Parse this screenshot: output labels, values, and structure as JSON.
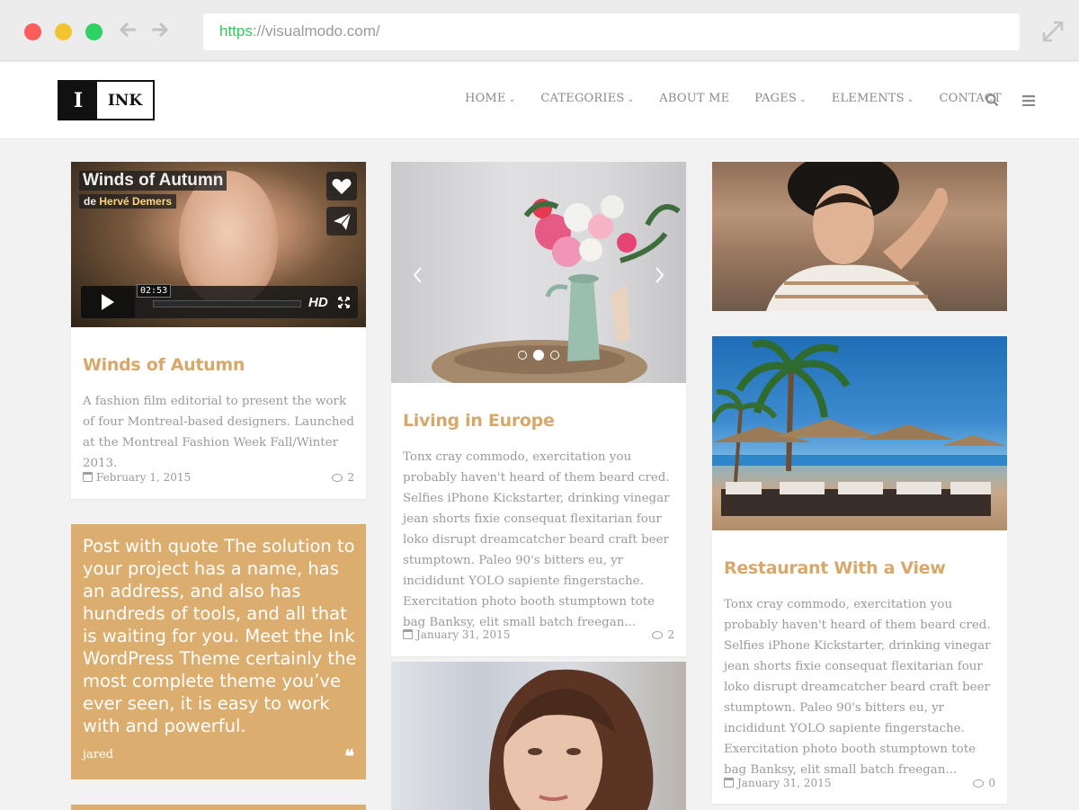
{
  "browser": {
    "url_protocol": "https",
    "url_rest": "://visualmodo.com/"
  },
  "site": {
    "logo_mark": "I",
    "logo_text": "INK",
    "menu": [
      {
        "label": "HOME",
        "has_dropdown": true
      },
      {
        "label": "CATEGORIES",
        "has_dropdown": true
      },
      {
        "label": "ABOUT ME",
        "has_dropdown": false
      },
      {
        "label": "PAGES",
        "has_dropdown": true
      },
      {
        "label": "ELEMENTS",
        "has_dropdown": true
      },
      {
        "label": "CONTACT",
        "has_dropdown": false
      }
    ],
    "accent_color": "#d7a86a",
    "quote_bg_color": "#dbae6f"
  },
  "posts": {
    "video": {
      "overlay_title": "Winds of Autumn",
      "overlay_author_prefix": "de",
      "overlay_author": "Hervé Demers",
      "timecode": "02:53",
      "hd_label": "HD",
      "title": "Winds of Autumn",
      "excerpt": "A fashion film editorial to present the work of four Montreal-based designers. Launched at the Montreal Fashion Week Fall/Winter 2013.",
      "date": "February 1, 2015",
      "comments": "2"
    },
    "quote": {
      "text": "Post with quote The solution to your project has a name, has an address, and also has hundreds of tools, and all that is waiting for you. Meet the Ink WordPress Theme certainly the most complete theme you’ve ever seen, it is easy to work with and powerful.",
      "author": "jared",
      "mark": "❝"
    },
    "europe": {
      "title": "Living in Europe",
      "excerpt": "Tonx cray commodo, exercitation you probably haven't heard of them beard cred. Selfies iPhone Kickstarter, drinking vinegar jean shorts fixie consequat flexitarian four loko disrupt dreamcatcher beard craft beer stumptown. Paleo 90's bitters eu, yr incididunt YOLO sapiente fingerstache. Exercitation photo booth stumptown tote bag Banksy, elit small batch freegan...",
      "date": "January 31, 2015",
      "comments": "2"
    },
    "restaurant": {
      "title": "Restaurant With a View",
      "excerpt": "Tonx cray commodo, exercitation you probably haven't heard of them beard cred. Selfies iPhone Kickstarter, drinking vinegar jean shorts fixie consequat flexitarian four loko disrupt dreamcatcher beard craft beer stumptown. Paleo 90's bitters eu, yr incididunt YOLO sapiente fingerstache. Exercitation photo booth stumptown tote bag Banksy, elit small batch freegan...",
      "date": "January 31, 2015",
      "comments": "0"
    }
  }
}
